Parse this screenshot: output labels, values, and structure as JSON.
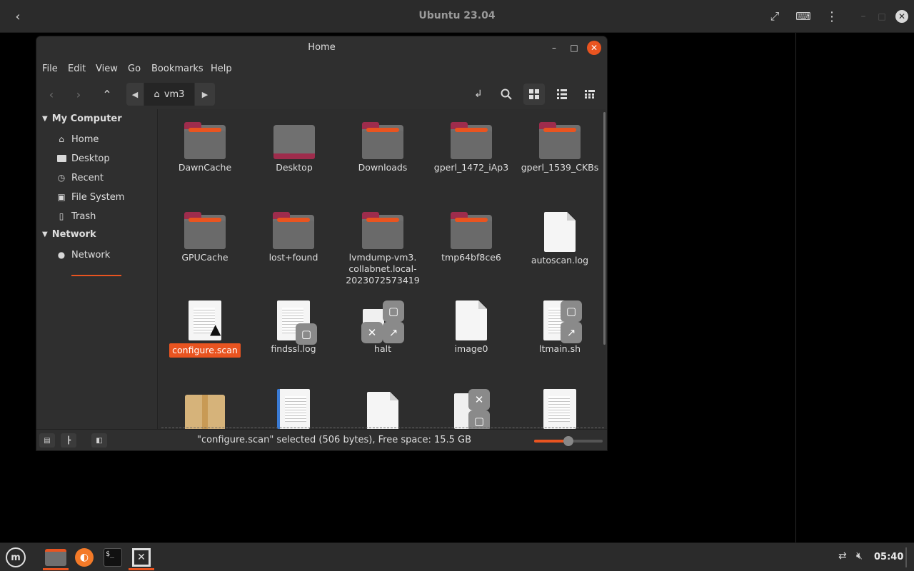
{
  "viewer": {
    "title": "Ubuntu 23.04",
    "back_icon": "chevron-left-icon",
    "fullscreen_icon": "expand-icon",
    "keyboard_icon": "keyboard-icon",
    "menu_icon": "kebab-icon",
    "close_icon": "close-icon"
  },
  "window": {
    "title": "Home",
    "close_color": "#e95420"
  },
  "menu": [
    "File",
    "Edit",
    "View",
    "Go",
    "Bookmarks",
    "Help"
  ],
  "path": {
    "crumb": "vm3"
  },
  "sidebar": {
    "sections": [
      {
        "label": "My Computer"
      },
      {
        "label": "Network"
      }
    ],
    "items": [
      {
        "label": "Home",
        "icon": "home-icon"
      },
      {
        "label": "Desktop",
        "icon": "desktop-icon"
      },
      {
        "label": "Recent",
        "icon": "clock-icon"
      },
      {
        "label": "File System",
        "icon": "drive-icon"
      },
      {
        "label": "Trash",
        "icon": "trash-icon"
      },
      {
        "label": "Network",
        "icon": "network-icon"
      }
    ]
  },
  "files": [
    {
      "name": "DawnCache",
      "type": "folder"
    },
    {
      "name": "Desktop",
      "type": "folder-desktop"
    },
    {
      "name": "Downloads",
      "type": "folder"
    },
    {
      "name": "gperl_1472_iAp3",
      "type": "folder"
    },
    {
      "name": "gperl_1539_CKBs",
      "type": "folder"
    },
    {
      "name": "GPUCache",
      "type": "folder"
    },
    {
      "name": "lost+found",
      "type": "folder"
    },
    {
      "name": "lvmdump-vm3.\ncollabnet.local-\n2023072573419",
      "type": "folder"
    },
    {
      "name": "tmp64bf8ce6",
      "type": "folder"
    },
    {
      "name": "autoscan.log",
      "type": "blank"
    },
    {
      "name": "configure.scan",
      "type": "text",
      "selected": true
    },
    {
      "name": "findssl.log",
      "type": "text-locked"
    },
    {
      "name": "halt",
      "type": "link-locked"
    },
    {
      "name": "image0",
      "type": "blank"
    },
    {
      "name": "ltmain.sh",
      "type": "text-link-locked"
    }
  ],
  "status": {
    "text": "\"configure.scan\" selected (506 bytes), Free space: 15.5 GB",
    "zoom_fraction": 0.5
  },
  "taskbar": {
    "clock": "05:40"
  },
  "accent": "#e95420"
}
